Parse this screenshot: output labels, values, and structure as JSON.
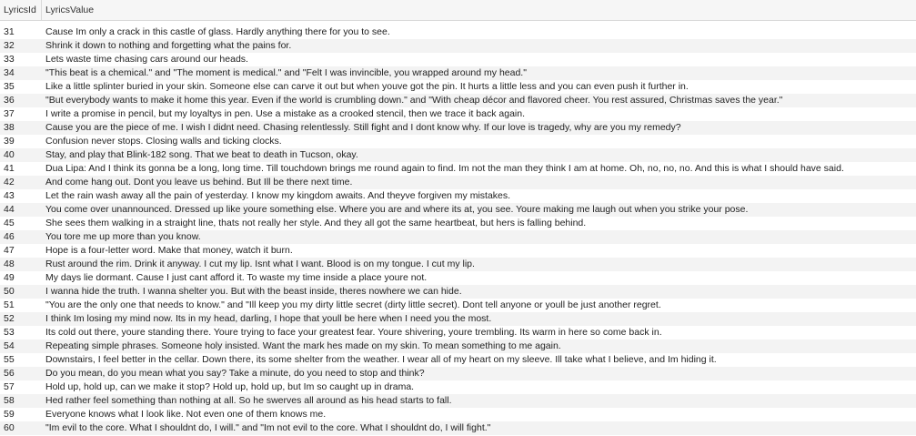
{
  "table": {
    "columns": [
      "LyricsId",
      "LyricsValue"
    ],
    "rows": [
      {
        "id": "31",
        "value": "Cause Im only a crack in this castle of glass. Hardly anything there for you to see."
      },
      {
        "id": "32",
        "value": "Shrink it down to nothing and forgetting what the pains for."
      },
      {
        "id": "33",
        "value": "Lets waste time chasing cars around our heads."
      },
      {
        "id": "34",
        "value": "\"This beat is a chemical.\" and \"The moment is medical.\" and \"Felt I was invincible, you wrapped around my head.\""
      },
      {
        "id": "35",
        "value": "Like a little splinter buried in your skin. Someone else can carve it out but when youve got the pin. It hurts a little less and you can even push it further in."
      },
      {
        "id": "36",
        "value": "\"But everybody wants to make it home this year. Even if the world is crumbling down.\" and \"With cheap décor and flavored cheer. You rest assured, Christmas saves the year.\""
      },
      {
        "id": "37",
        "value": "I write a promise in pencil, but my loyaltys in pen. Use a mistake as a crooked stencil, then we trace it back again."
      },
      {
        "id": "38",
        "value": "Cause you are the piece of me. I wish I didnt need. Chasing relentlessly. Still fight and I dont know why. If our love is tragedy, why are you my remedy?"
      },
      {
        "id": "39",
        "value": "Confusion never stops. Closing walls and ticking clocks."
      },
      {
        "id": "40",
        "value": "Stay, and play that Blink-182 song. That we beat to death in Tucson, okay."
      },
      {
        "id": "41",
        "value": "Dua Lipa: And I think its gonna be a long, long time. Till touchdown brings me round again to find. Im not the man they think I am at home. Oh, no, no, no. And this is what I should have said."
      },
      {
        "id": "42",
        "value": "And come hang out. Dont you leave us behind. But Ill be there next time."
      },
      {
        "id": "43",
        "value": "Let the rain wash away all the pain of yesterday. I know my kingdom awaits. And theyve forgiven my mistakes."
      },
      {
        "id": "44",
        "value": "You come over unannounced. Dressed up like youre something else. Where you are and where its at, you see. Youre making me laugh out when you strike your pose."
      },
      {
        "id": "45",
        "value": "She sees them walking in a straight line, thats not really her style. And they all got the same heartbeat, but hers is falling behind."
      },
      {
        "id": "46",
        "value": "You tore me up more than you know."
      },
      {
        "id": "47",
        "value": "Hope is a four-letter word. Make that money, watch it burn."
      },
      {
        "id": "48",
        "value": "Rust around the rim. Drink it anyway. I cut my lip. Isnt what I want. Blood is on my tongue. I cut my lip."
      },
      {
        "id": "49",
        "value": "My days lie dormant. Cause I just cant afford it. To waste my time inside a place youre not."
      },
      {
        "id": "50",
        "value": "I wanna hide the truth. I wanna shelter you. But with the beast inside, theres nowhere we can hide."
      },
      {
        "id": "51",
        "value": "\"You are the only one that needs to know.\" and \"Ill keep you my dirty little secret (dirty little secret). Dont tell anyone or youll be just another regret."
      },
      {
        "id": "52",
        "value": "I think Im losing my mind now. Its in my head, darling, I hope that youll be here when I need you the most."
      },
      {
        "id": "53",
        "value": "Its cold out there, youre standing there. Youre trying to face your greatest fear. Youre shivering, youre trembling. Its warm in here so come back in."
      },
      {
        "id": "54",
        "value": "Repeating simple phrases. Someone holy insisted. Want the mark hes made on my skin. To mean something to me again."
      },
      {
        "id": "55",
        "value": "Downstairs, I feel better in the cellar. Down there, its some shelter from the weather. I wear all of my heart on my sleeve. Ill take what I believe, and Im hiding it."
      },
      {
        "id": "56",
        "value": "Do you mean, do you mean what you say? Take a minute, do you need to stop and think?"
      },
      {
        "id": "57",
        "value": "Hold up, hold up, can we make it stop? Hold up, hold up, but Im so caught up in drama."
      },
      {
        "id": "58",
        "value": "Hed rather feel something than nothing at all. So he swerves all around as his head starts to fall."
      },
      {
        "id": "59",
        "value": "Everyone knows what I look like. Not even one of them knows me."
      },
      {
        "id": "60",
        "value": "\"Im evil to the core. What I shouldnt do, I will.\" and \"Im not evil to the core. What I shouldnt do, I will fight.\""
      }
    ]
  }
}
